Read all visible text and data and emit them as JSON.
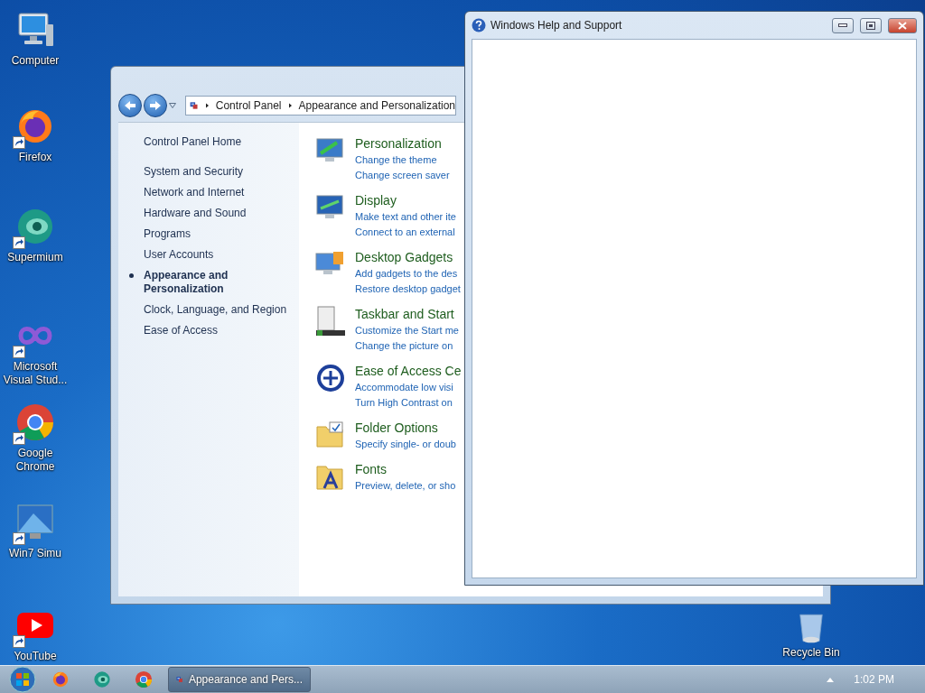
{
  "desktop_icons": [
    {
      "kind": "computer",
      "label": "Computer",
      "shortcut": false
    },
    {
      "kind": "firefox",
      "label": "Firefox",
      "shortcut": true
    },
    {
      "kind": "supermium",
      "label": "Supermium",
      "shortcut": true
    },
    {
      "kind": "visualstudio",
      "label": "Microsoft Visual Stud...",
      "shortcut": true
    },
    {
      "kind": "chrome",
      "label": "Google Chrome",
      "shortcut": true
    },
    {
      "kind": "simulator",
      "label": "Win7 Simu",
      "shortcut": true
    },
    {
      "kind": "youtube",
      "label": "YouTube",
      "shortcut": true
    }
  ],
  "recycle_bin": {
    "label": "Recycle Bin"
  },
  "control_panel": {
    "breadcrumb": [
      "Control Panel",
      "Appearance and Personalization"
    ],
    "sidebar": [
      {
        "label": "Control Panel Home",
        "selected": false
      },
      {
        "label": "System and Security",
        "selected": false
      },
      {
        "label": "Network and Internet",
        "selected": false
      },
      {
        "label": "Hardware and Sound",
        "selected": false
      },
      {
        "label": "Programs",
        "selected": false
      },
      {
        "label": "User Accounts",
        "selected": false
      },
      {
        "label": "Appearance and Personalization",
        "selected": true
      },
      {
        "label": "Clock, Language, and Region",
        "selected": false
      },
      {
        "label": "Ease of Access",
        "selected": false
      }
    ],
    "categories": [
      {
        "kind": "personalization",
        "title": "Personalization",
        "links": [
          "Change the theme",
          "Change screen saver"
        ]
      },
      {
        "kind": "display",
        "title": "Display",
        "links": [
          "Make text and other ite",
          "Connect to an external"
        ]
      },
      {
        "kind": "gadgets",
        "title": "Desktop Gadgets",
        "links": [
          "Add gadgets to the des",
          "Restore desktop gadget"
        ]
      },
      {
        "kind": "taskbar",
        "title": "Taskbar and Start",
        "links": [
          "Customize the Start me",
          "Change the picture on"
        ]
      },
      {
        "kind": "ease",
        "title": "Ease of Access Ce",
        "links": [
          "Accommodate low visi",
          "Turn High Contrast on"
        ]
      },
      {
        "kind": "folder",
        "title": "Folder Options",
        "links": [
          "Specify single- or doub"
        ]
      },
      {
        "kind": "fonts",
        "title": "Fonts",
        "links": [
          "Preview, delete, or sho"
        ]
      }
    ]
  },
  "help_window": {
    "title": "Windows Help and Support"
  },
  "taskbar": {
    "pinned": [
      {
        "kind": "firefox"
      },
      {
        "kind": "supermium"
      },
      {
        "kind": "chrome"
      }
    ],
    "task": {
      "label": "Appearance and Pers..."
    },
    "clock": "1:02 PM"
  }
}
